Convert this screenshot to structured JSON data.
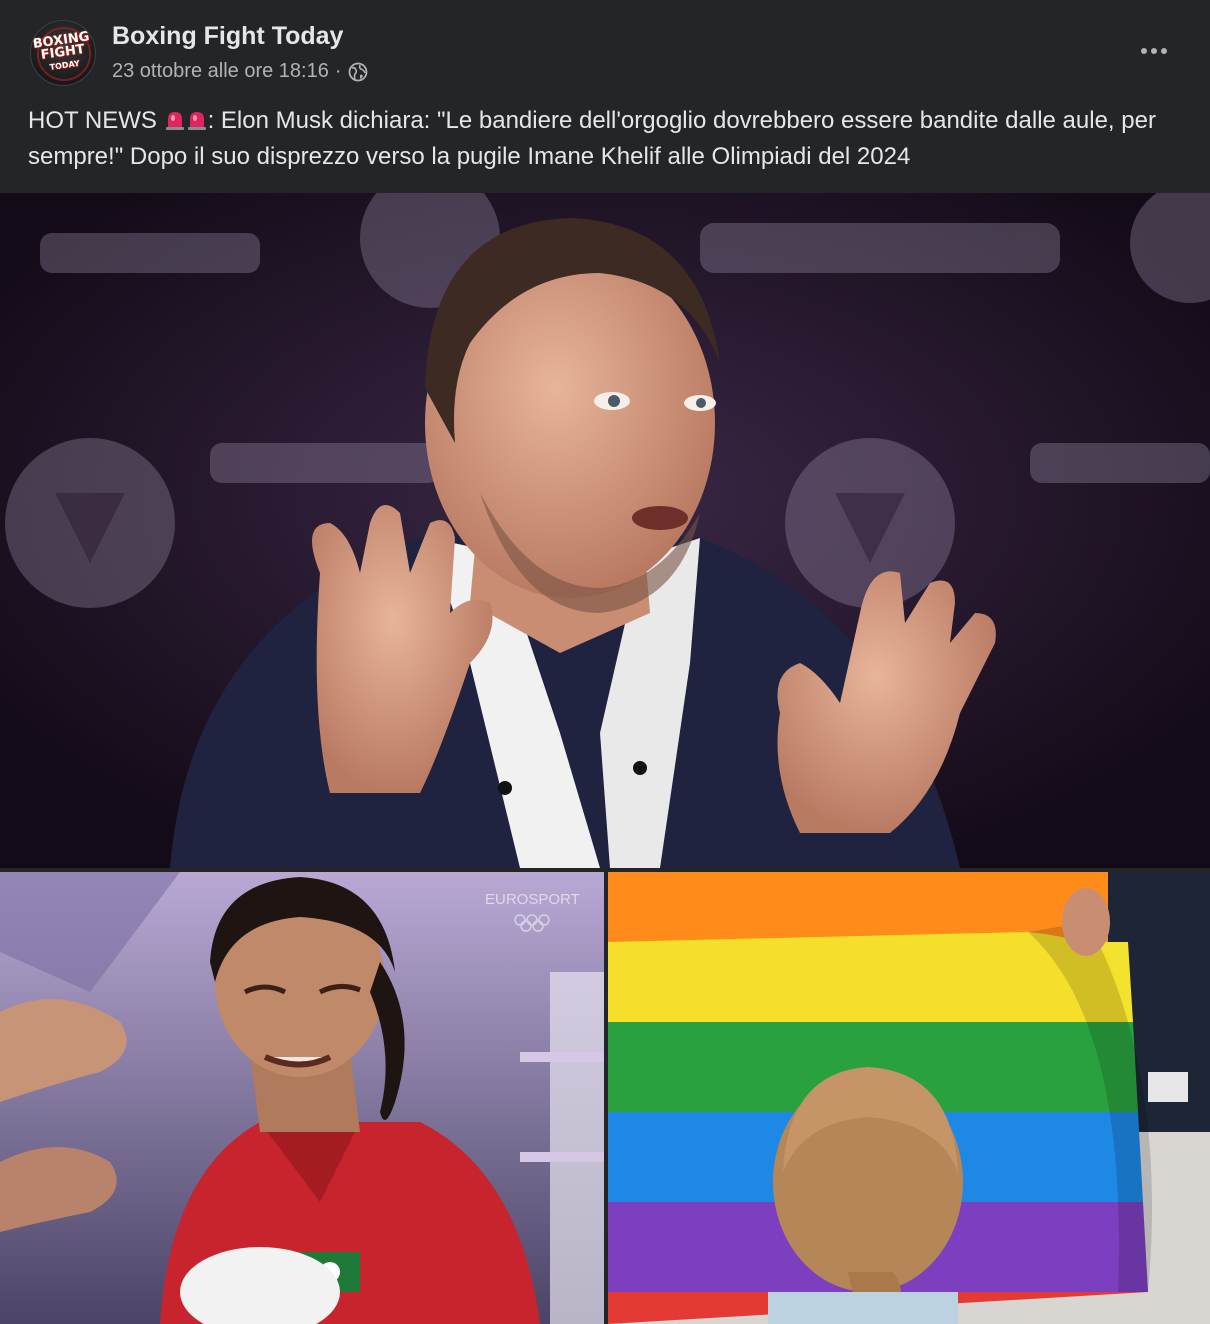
{
  "post": {
    "author": "Boxing Fight Today",
    "timestamp": "23 ottobre alle ore 18:16",
    "separator": "·",
    "privacy_icon": "globe-icon",
    "more_icon": "more-options-icon",
    "avatar_text": "BOXING FIGHT TODAY",
    "caption_prefix": "HOT NEWS",
    "caption_emoji": "siren-icon",
    "caption_text": ": Elon Musk dichiara: \"Le bandiere dell'orgoglio dovrebbero essere bandite dalle aule, per sempre!\" Dopo il suo disprezzo verso la pugile Imane Khelif alle Olimpiadi del 2024"
  },
  "media": {
    "left_watermark": "EUROSPORT",
    "colors": {
      "background": "#242526",
      "text_primary": "#e4e6eb",
      "text_secondary": "#b0b3b8",
      "siren_red": "#e0245e"
    }
  }
}
